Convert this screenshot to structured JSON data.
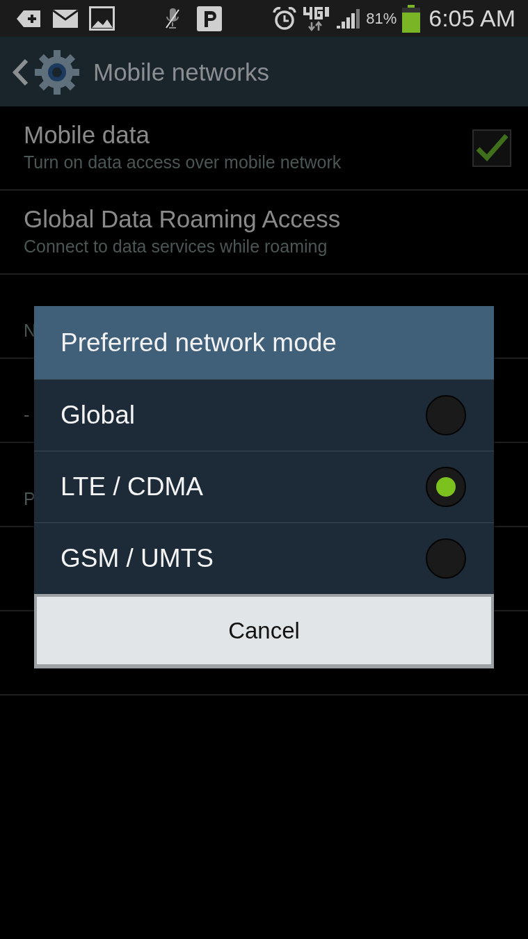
{
  "status_bar": {
    "battery_percent": "81%",
    "time": "6:05 AM"
  },
  "action_bar": {
    "title": "Mobile networks"
  },
  "settings": [
    {
      "title": "Mobile data",
      "subtitle": "Turn on data access over mobile network",
      "kind": "checkbox",
      "checked": true
    },
    {
      "title": "Global Data Roaming Access",
      "subtitle": "Connect to data services while roaming",
      "kind": "plain"
    },
    {
      "subtitle": "N",
      "kind": "plain"
    },
    {
      "subtitle": "-",
      "kind": "plain"
    },
    {
      "subtitle": "P",
      "kind": "plain"
    },
    {
      "kind": "plain"
    },
    {
      "kind": "plain"
    }
  ],
  "dialog": {
    "title": "Preferred network mode",
    "options": [
      {
        "label": "Global",
        "selected": false
      },
      {
        "label": "LTE / CDMA",
        "selected": true
      },
      {
        "label": "GSM / UMTS",
        "selected": false
      }
    ],
    "cancel": "Cancel"
  }
}
